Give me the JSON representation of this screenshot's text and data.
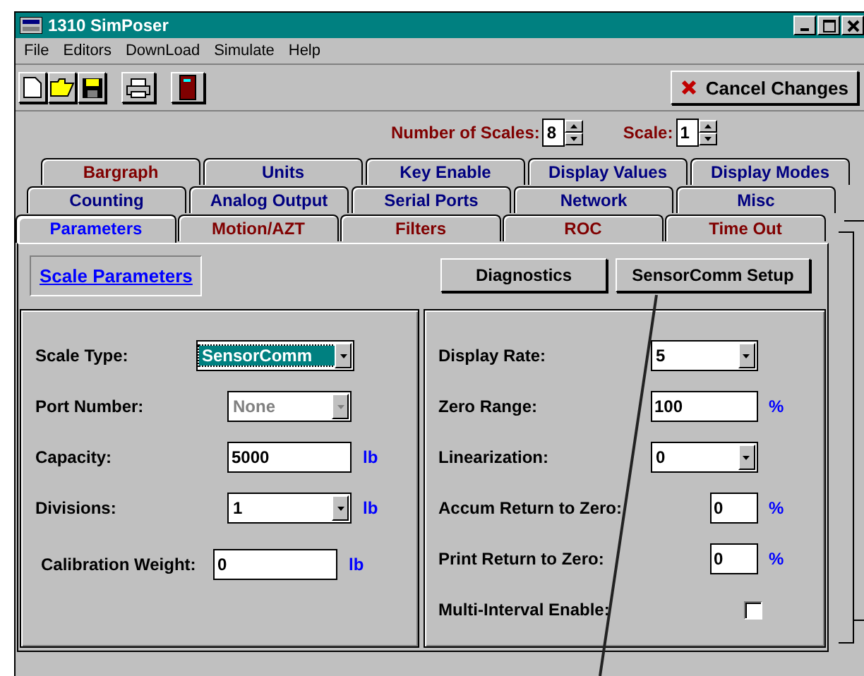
{
  "window": {
    "title": "1310 SimPoser"
  },
  "menu": [
    "File",
    "Editors",
    "DownLoad",
    "Simulate",
    "Help"
  ],
  "toolbar": {
    "cancel_button": "Cancel Changes"
  },
  "scales": {
    "count_label": "Number of Scales:",
    "count": "8",
    "scale_label": "Scale:",
    "scale": "1"
  },
  "tab_rows": [
    [
      {
        "label": "Bargraph",
        "color": "#800000",
        "selected": false
      },
      {
        "label": "Units",
        "color": "#000080",
        "selected": false
      },
      {
        "label": "Key Enable",
        "color": "#000080",
        "selected": false
      },
      {
        "label": "Display Values",
        "color": "#000080",
        "selected": false
      },
      {
        "label": "Display Modes",
        "color": "#000080",
        "selected": false
      }
    ],
    [
      {
        "label": "Counting",
        "color": "#000080",
        "selected": false
      },
      {
        "label": "Analog Output",
        "color": "#000080",
        "selected": false
      },
      {
        "label": "Serial Ports",
        "color": "#000080",
        "selected": false
      },
      {
        "label": "Network",
        "color": "#000080",
        "selected": false
      },
      {
        "label": "Misc",
        "color": "#000080",
        "selected": false
      }
    ],
    [
      {
        "label": "Parameters",
        "color": "#0000ff",
        "selected": true
      },
      {
        "label": "Motion/AZT",
        "color": "#800000",
        "selected": false
      },
      {
        "label": "Filters",
        "color": "#800000",
        "selected": false
      },
      {
        "label": "ROC",
        "color": "#800000",
        "selected": false
      },
      {
        "label": "Time Out",
        "color": "#800000",
        "selected": false
      }
    ]
  ],
  "panel": {
    "link": "Scale Parameters",
    "buttons": [
      "Diagnostics",
      "SensorComm Setup"
    ],
    "left_fields": [
      {
        "kind": "dropdown",
        "label": "Scale Type:",
        "value": "SensorComm",
        "focused": true,
        "disabled": false
      },
      {
        "kind": "dropdown",
        "label": "Port Number:",
        "value": "None",
        "focused": false,
        "disabled": true
      },
      {
        "kind": "text",
        "label": "Capacity:",
        "value": "5000",
        "unit": "lb",
        "focused": false,
        "disabled": false
      },
      {
        "kind": "dropdown",
        "label": "Divisions:",
        "value": "1",
        "unit": "lb",
        "focused": false,
        "disabled": false
      },
      {
        "kind": "text",
        "label": "Calibration Weight:",
        "value": "0",
        "unit": "lb",
        "focused": false,
        "disabled": false
      }
    ],
    "right_fields": [
      {
        "kind": "dropdown",
        "label": "Display Rate:",
        "value": "5"
      },
      {
        "kind": "text",
        "label": "Zero Range:",
        "value": "100",
        "unit": "%"
      },
      {
        "kind": "dropdown",
        "label": "Linearization:",
        "value": "0"
      },
      {
        "kind": "short",
        "label": "Accum Return to Zero:",
        "value": "0",
        "unit": "%"
      },
      {
        "kind": "short",
        "label": "Print Return to Zero:",
        "value": "0",
        "unit": "%"
      },
      {
        "kind": "checkbox",
        "label": "Multi-Interval Enable:",
        "checked": false
      }
    ]
  }
}
